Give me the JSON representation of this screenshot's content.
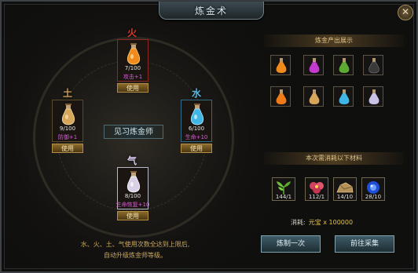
{
  "window": {
    "title": "炼金术",
    "close_icon": "close-icon"
  },
  "elements": {
    "fire": {
      "label": "火",
      "count": "7/100",
      "bonus": "攻击+1",
      "use": "使用",
      "color": "#d23a2a"
    },
    "earth": {
      "label": "土",
      "count": "9/100",
      "bonus": "防御+1",
      "use": "使用",
      "color": "#c79a55"
    },
    "water": {
      "label": "水",
      "count": "6/100",
      "bonus": "生命+10",
      "use": "使用",
      "color": "#5ab8e0"
    },
    "qi": {
      "label": "气",
      "count": "8/100",
      "bonus": "生命恢复+10",
      "use": "使用",
      "color": "#d9c9f0"
    }
  },
  "center_title": "见习炼金师",
  "hint": {
    "line1": "水、火、土、气使用次数全达到上限后,",
    "line2": "自动升级炼金师等级。"
  },
  "output": {
    "title": "炼金产出展示",
    "items": [
      {
        "icon": "orange-potion-icon"
      },
      {
        "icon": "purple-potion-icon"
      },
      {
        "icon": "green-potion-icon"
      },
      {
        "icon": "black-potion-icon"
      },
      {
        "icon": "orange-potion-icon"
      },
      {
        "icon": "amber-potion-icon"
      },
      {
        "icon": "cyan-potion-icon"
      },
      {
        "icon": "violet-potion-icon"
      }
    ]
  },
  "materials": {
    "title": "本次需消耗以下材料",
    "items": [
      {
        "icon": "herb-icon",
        "count": "144/1"
      },
      {
        "icon": "flower-icon",
        "count": "112/1"
      },
      {
        "icon": "ore-icon",
        "count": "14/10"
      },
      {
        "icon": "blue-crystal-icon",
        "count": "28/10"
      }
    ]
  },
  "cost": {
    "label": "消耗:",
    "value": "元宝 x 100000"
  },
  "buttons": {
    "craft": "炼制一次",
    "gather": "前往采集"
  }
}
